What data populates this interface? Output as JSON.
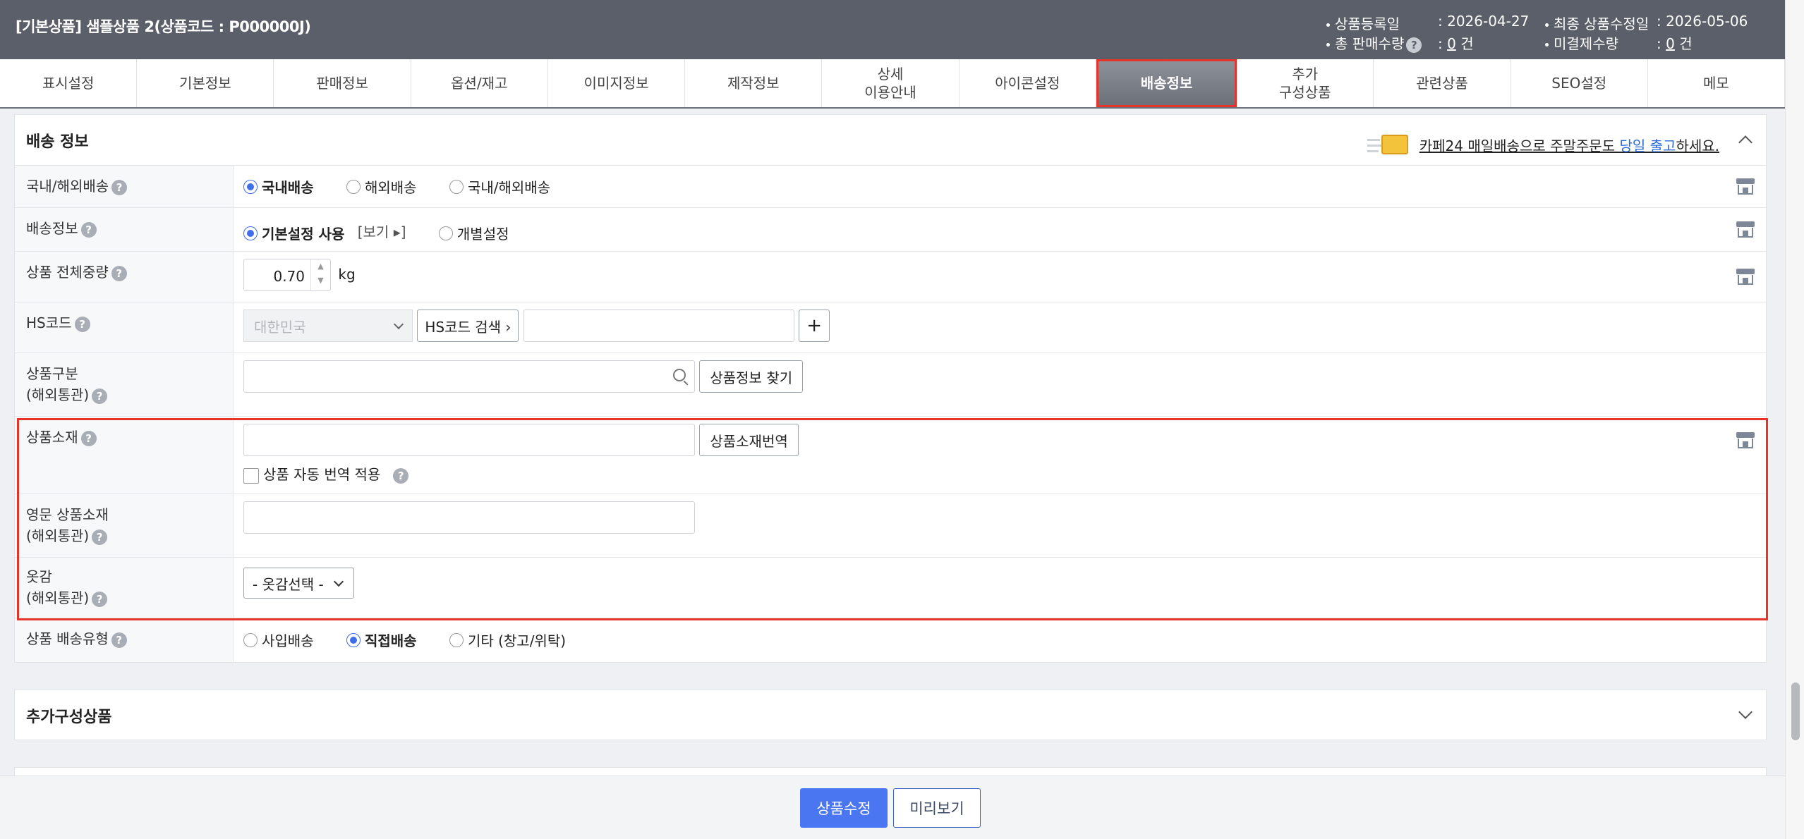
{
  "header": {
    "title": "[기본상품] 샘플상품 2(상품코드 : P000000J)",
    "reg_label": "상품등록일",
    "reg_value": ": 2026-04-27",
    "mod_label": "최종 상품수정일",
    "mod_value": ": 2026-05-06",
    "sales_label": "총 판매수량",
    "sales_prefix": ": ",
    "sales_count": "0",
    "sales_unit": " 건",
    "unpaid_label": "미결제수량",
    "unpaid_prefix": ": ",
    "unpaid_count": "0",
    "unpaid_unit": " 건"
  },
  "tabs": [
    "표시설정",
    "기본정보",
    "판매정보",
    "옵션/재고",
    "이미지정보",
    "제작정보",
    "상세\n이용안내",
    "아이콘설정",
    "배송정보",
    "추가\n구성상품",
    "관련상품",
    "SEO설정",
    "메모"
  ],
  "active_tab": "배송정보",
  "shipping": {
    "section_title": "배송 정보",
    "promo_text_1": "카페24 매일배송으로 주말주문도 ",
    "promo_link": "당일 출고",
    "promo_text_2": "하세요.",
    "rows": {
      "domestic": {
        "label": "국내/해외배송",
        "options": [
          "국내배송",
          "해외배송",
          "국내/해외배송"
        ],
        "selected": "국내배송"
      },
      "info": {
        "label": "배송정보",
        "options": [
          "기본설정 사용",
          "개별설정"
        ],
        "view_link": "[보기 ▸]",
        "selected": "기본설정 사용"
      },
      "weight": {
        "label": "상품 전체중량",
        "value": "0.70",
        "unit": "kg"
      },
      "hscode": {
        "label": "HS코드",
        "country_placeholder": "대한민국",
        "search_button": "HS코드 검색 ›",
        "add_button": "+"
      },
      "category": {
        "label_line1": "상품구분",
        "label_line2": "(해외통관)",
        "find_button": "상품정보 찾기"
      },
      "material": {
        "label": "상품소재",
        "translate_button": "상품소재번역",
        "auto_translate": "상품 자동 번역 적용"
      },
      "material_en": {
        "label_line1": "영문 상품소재",
        "label_line2": "(해외통관)"
      },
      "fabric": {
        "label_line1": "옷감",
        "label_line2": "(해외통관)",
        "select_value": "- 옷감선택 -"
      },
      "delivery_type": {
        "label": "상품 배송유형",
        "options": [
          "사입배송",
          "직접배송",
          "기타 (창고/위탁)"
        ],
        "selected": "직접배송"
      }
    }
  },
  "extra": {
    "section_title": "추가구성상품"
  },
  "footer": {
    "save_button": "상품수정",
    "preview_button": "미리보기"
  },
  "colors": {
    "accent": "#4b76f2",
    "highlight": "#e5352b",
    "header_bg": "#5a5f69"
  }
}
